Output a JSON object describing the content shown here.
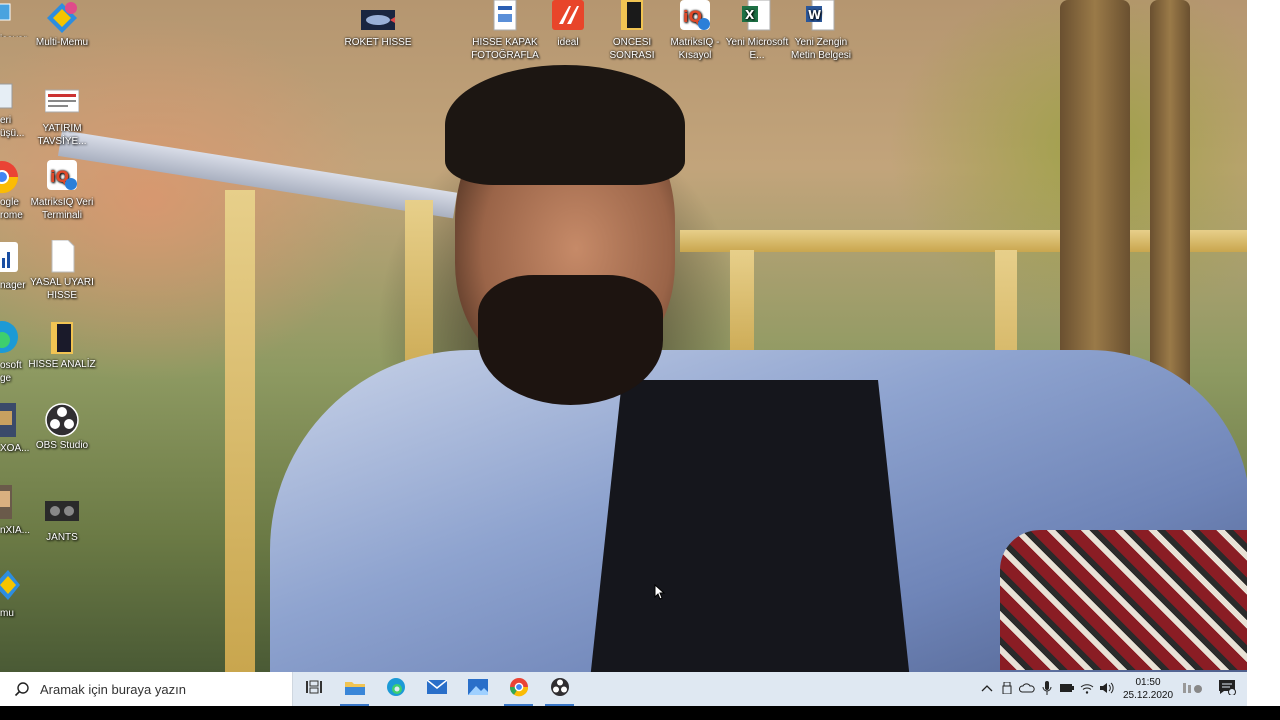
{
  "desktop_icons": [
    {
      "label": "Multi-Memu",
      "icon": "multi-memu-icon"
    },
    {
      "label": "ROKET HISSE",
      "icon": "rocket-icon"
    },
    {
      "label": "HISSE KAPAK FOTOĞRAFLA",
      "icon": "document-icon"
    },
    {
      "label": "ideal",
      "icon": "ideal-app-icon"
    },
    {
      "label": "ONCESI SONRASI",
      "icon": "folder-icon"
    },
    {
      "label": "MatriksIQ - Kısayol",
      "icon": "matriksiq-icon"
    },
    {
      "label": "Yeni Microsoft E...",
      "icon": "excel-icon"
    },
    {
      "label": "Yeni Zengin Metin Belgesi",
      "icon": "word-icon"
    },
    {
      "label": "YATIRIM TAVSİYE...",
      "icon": "image-file-icon"
    },
    {
      "label": "MatriksIQ Veri Terminali",
      "icon": "matriksiq-icon"
    },
    {
      "label": "YASAL UYARI HISSE",
      "icon": "text-file-icon"
    },
    {
      "label": "HISSE ANALİZ",
      "icon": "folder-icon"
    },
    {
      "label": "OBS Studio",
      "icon": "obs-icon"
    },
    {
      "label": "JANTS",
      "icon": "video-file-icon"
    }
  ],
  "cut_icons": [
    {
      "label": "isayar",
      "icon": "computer-icon"
    },
    {
      "label": "eri\nüşü...",
      "icon": "recycle-bin-icon"
    },
    {
      "label": "ogle\nrome",
      "icon": "chrome-icon"
    },
    {
      "label": "nager",
      "icon": "chart-icon"
    },
    {
      "label": "osoft\nge",
      "icon": "edge-icon"
    },
    {
      "label": "XOA...",
      "icon": "game-icon"
    },
    {
      "label": "nXIA...",
      "icon": "game-icon"
    },
    {
      "label": "mu",
      "icon": "memu-icon"
    }
  ],
  "taskbar": {
    "search_placeholder": "Aramak için buraya yazın",
    "apps": [
      {
        "name": "task-view",
        "icon": "task-view-icon"
      },
      {
        "name": "file-explorer",
        "icon": "folder-icon"
      },
      {
        "name": "edge",
        "icon": "edge-icon"
      },
      {
        "name": "mail",
        "icon": "mail-icon"
      },
      {
        "name": "photos",
        "icon": "photos-icon"
      },
      {
        "name": "chrome",
        "icon": "chrome-icon"
      },
      {
        "name": "obs",
        "icon": "obs-icon"
      }
    ],
    "clock": {
      "time": "01:50",
      "date": "25.12.2020"
    }
  },
  "colors": {
    "taskbar_bg": "#dfe8f2",
    "accent": "#3b78c8"
  }
}
